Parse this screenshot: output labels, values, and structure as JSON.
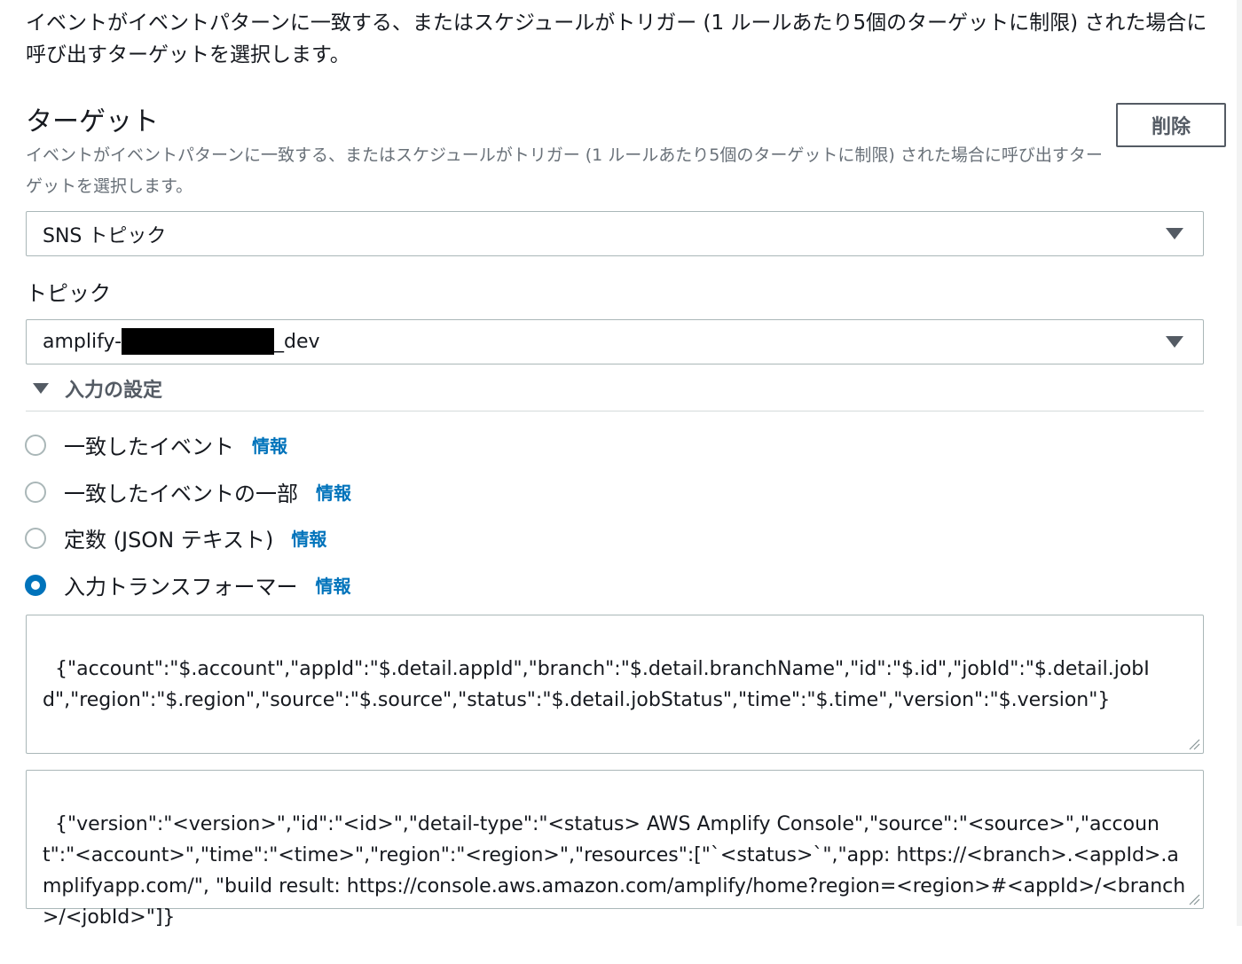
{
  "intro_text": "イベントがイベントパターンに一致する、またはスケジュールがトリガー (1 ルールあたり5個のターゲットに制限) された場合に呼び出すターゲットを選択します。",
  "target_section": {
    "title": "ターゲット",
    "description": "イベントがイベントパターンに一致する、またはスケジュールがトリガー (1 ルールあたり5個のターゲットに制限) された場合に呼び出すターゲットを選択します。",
    "delete_label": "削除",
    "target_type": "SNS トピック"
  },
  "topic": {
    "label": "トピック",
    "value_prefix": "amplify-",
    "value_suffix": "_dev"
  },
  "input_config": {
    "title": "入力の設定",
    "info_label": "情報",
    "options": [
      {
        "label": "一致したイベント",
        "checked": false
      },
      {
        "label": "一致したイベントの一部",
        "checked": false
      },
      {
        "label": "定数 (JSON テキスト)",
        "checked": false
      },
      {
        "label": "入力トランスフォーマー",
        "checked": true
      }
    ],
    "input_paths": "{\"account\":\"$.account\",\"appId\":\"$.detail.appId\",\"branch\":\"$.detail.branchName\",\"id\":\"$.id\",\"jobId\":\"$.detail.jobId\",\"region\":\"$.region\",\"source\":\"$.source\",\"status\":\"$.detail.jobStatus\",\"time\":\"$.time\",\"version\":\"$.version\"}",
    "input_template": "{\"version\":\"<version>\",\"id\":\"<id>\",\"detail-type\":\"<status> AWS Amplify Console\",\"source\":\"<source>\",\"account\":\"<account>\",\"time\":\"<time>\",\"region\":\"<region>\",\"resources\":[\"`<status>`\",\"app: https://<branch>.<appId>.amplifyapp.com/\", \"build result: https://console.aws.amazon.com/amplify/home?region=<region>#<appId>/<branch>/<jobId>\"]}"
  }
}
